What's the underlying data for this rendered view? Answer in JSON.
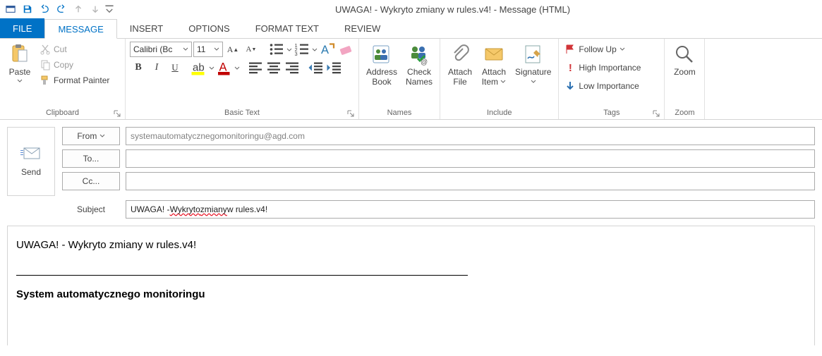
{
  "title": "UWAGA! - Wykryto zmiany w rules.v4! - Message (HTML)",
  "tabs": {
    "file": "FILE",
    "message": "MESSAGE",
    "insert": "INSERT",
    "options": "OPTIONS",
    "formattext": "FORMAT TEXT",
    "review": "REVIEW"
  },
  "ribbon": {
    "clipboard": {
      "paste": "Paste",
      "cut": "Cut",
      "copy": "Copy",
      "format_painter": "Format Painter",
      "label": "Clipboard"
    },
    "basictext": {
      "font": "Calibri (Bc",
      "size": "11",
      "label": "Basic Text"
    },
    "names": {
      "address_book_l1": "Address",
      "address_book_l2": "Book",
      "check_names_l1": "Check",
      "check_names_l2": "Names",
      "label": "Names"
    },
    "include": {
      "attach_file_l1": "Attach",
      "attach_file_l2": "File",
      "attach_item_l1": "Attach",
      "attach_item_l2": "Item",
      "signature": "Signature",
      "label": "Include"
    },
    "tags": {
      "follow_up": "Follow Up",
      "high": "High Importance",
      "low": "Low Importance",
      "label": "Tags"
    },
    "zoom": {
      "zoom": "Zoom",
      "label": "Zoom"
    }
  },
  "compose": {
    "send": "Send",
    "from_btn": "From",
    "from_value": "systemautomatycznegomonitoringu@agd.com",
    "to_btn": "To...",
    "to_value": "",
    "cc_btn": "Cc...",
    "cc_value": "",
    "subject_label": "Subject",
    "subject_value": "UWAGA! - Wykryto zmiany w rules.v4!",
    "subject_p1": "UWAGA! - ",
    "subject_w1": "Wykryto",
    "subject_sp": " ",
    "subject_w2": "zmiany",
    "subject_p2": " w rules.v4!"
  },
  "body": {
    "line1": "UWAGA! - Wykryto zmiany w rules.v4!",
    "signature": "System automatycznego monitoringu"
  }
}
